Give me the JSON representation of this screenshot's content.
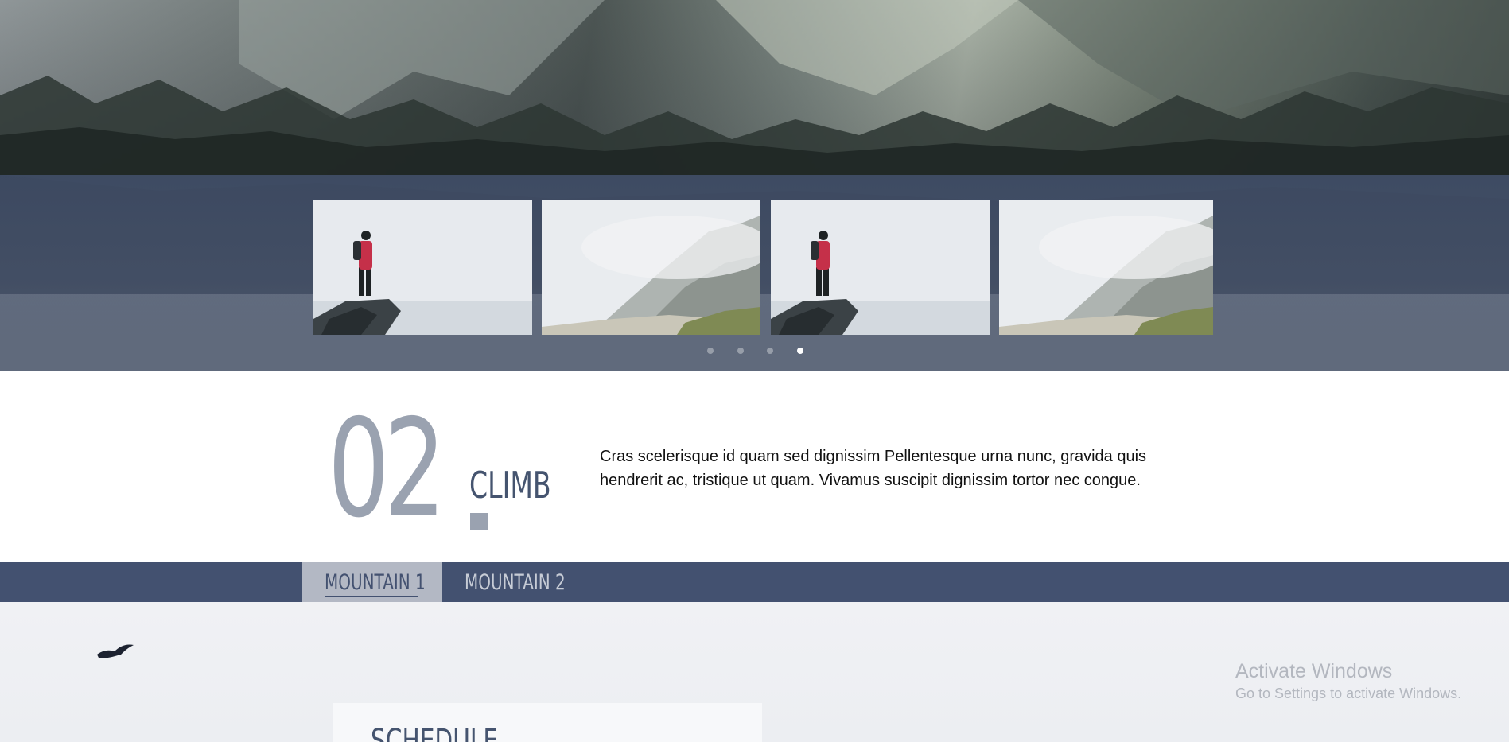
{
  "hero": {
    "image": "mountain-forest-landscape"
  },
  "carousel": {
    "slides": [
      {
        "image": "hiker-on-rock"
      },
      {
        "image": "misty-mountain-valley"
      },
      {
        "image": "hiker-on-rock"
      },
      {
        "image": "misty-mountain-valley"
      }
    ],
    "dots_count": 4,
    "active_dot": 4
  },
  "step": {
    "number": "02",
    "word": "CLIMB",
    "text": "Cras scelerisque id quam sed dignissim Pellentesque urna nunc, gravida quis hendrerit ac, tristique ut quam. Vivamus suscipit dignissim tortor nec congue."
  },
  "tabs": [
    {
      "label": "MOUNTAIN 1",
      "active": true
    },
    {
      "label": "MOUNTAIN 2",
      "active": false
    }
  ],
  "schedule": {
    "title": "SCHEDULE"
  },
  "watermark": {
    "title": "Activate Windows",
    "subtitle": "Go to Settings to activate Windows."
  },
  "colors": {
    "navy": "#435170",
    "muted_number": "#9aa2b0",
    "active_tab_bg": "#b3b8c4"
  }
}
